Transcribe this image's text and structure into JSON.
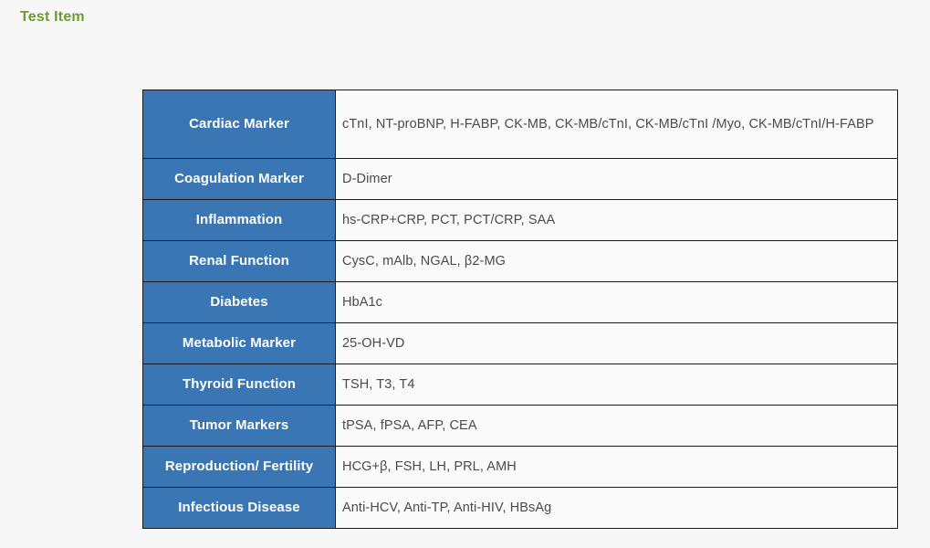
{
  "page": {
    "title": "Test Item",
    "background_color": "#f7f7f7",
    "title_color": "#6d9a35"
  },
  "table": {
    "header_color": "#3a76b4",
    "header_text_color": "#ffffff",
    "cell_background": "#fafafa",
    "cell_text_color": "#4b4b4b",
    "border_color": "#1a1a1a",
    "rows": [
      {
        "category": "Cardiac Marker",
        "items": "cTnI, NT-proBNP, H-FABP, CK-MB, CK-MB/cTnI, CK-MB/cTnI /Myo, CK-MB/cTnI/H-FABP"
      },
      {
        "category": "Coagulation Marker",
        "items": "D-Dimer"
      },
      {
        "category": "Inflammation",
        "items": "hs-CRP+CRP, PCT, PCT/CRP, SAA"
      },
      {
        "category": "Renal Function",
        "items": "CysC, mAlb, NGAL, β2-MG"
      },
      {
        "category": "Diabetes",
        "items": "HbA1c"
      },
      {
        "category": "Metabolic Marker",
        "items": "25-OH-VD"
      },
      {
        "category": "Thyroid Function",
        "items": "TSH, T3, T4"
      },
      {
        "category": "Tumor Markers",
        "items": "tPSA, fPSA, AFP, CEA"
      },
      {
        "category": "Reproduction/ Fertility",
        "items": "HCG+β, FSH, LH, PRL, AMH"
      },
      {
        "category": "Infectious Disease",
        "items": "Anti-HCV, Anti-TP, Anti-HIV, HBsAg"
      }
    ]
  }
}
